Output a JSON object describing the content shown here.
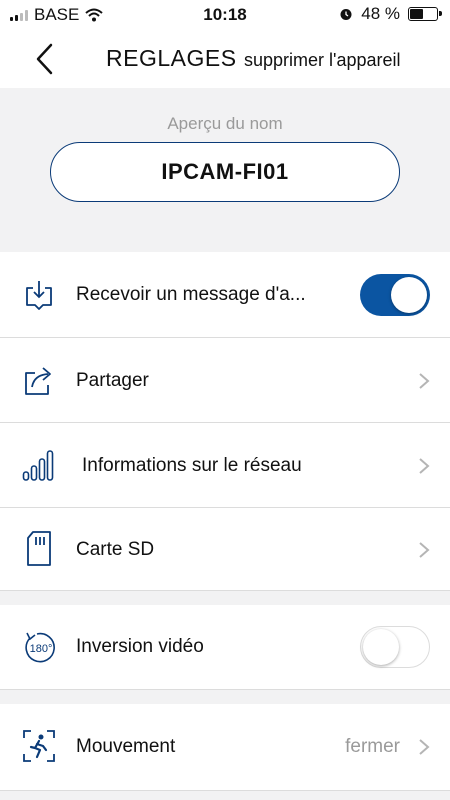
{
  "status_bar": {
    "carrier": "BASE",
    "time": "10:18",
    "battery_text": "48 %",
    "battery_level": 0.48,
    "icons": [
      "signal-icon",
      "wifi-icon",
      "alarm-icon",
      "battery-icon"
    ]
  },
  "nav": {
    "title": "REGLAGES",
    "action_label": "supprimer l'appareil",
    "back_icon": "chevron-left-icon"
  },
  "name_preview": {
    "label": "Aperçu du nom",
    "value": "IPCAM-FI01"
  },
  "settings": {
    "receive_message": {
      "label": "Recevoir un message d'a...",
      "enabled": true,
      "icon": "download-message-icon"
    },
    "share": {
      "label": "Partager",
      "icon": "share-icon"
    },
    "network_info": {
      "label": "Informations sur le réseau",
      "icon": "signal-bars-icon"
    },
    "sd_card": {
      "label": "Carte SD",
      "icon": "sd-card-icon"
    },
    "video_flip": {
      "label": "Inversion vidéo",
      "enabled": false,
      "icon": "rotate-180-icon"
    },
    "motion": {
      "label": "Mouvement",
      "value": "fermer",
      "icon": "motion-detection-icon"
    }
  },
  "colors": {
    "accent": "#0b55a2",
    "icon_blue": "#0b3b78",
    "section_bg": "#f2f2f3",
    "secondary_text": "#9a9a9a"
  }
}
